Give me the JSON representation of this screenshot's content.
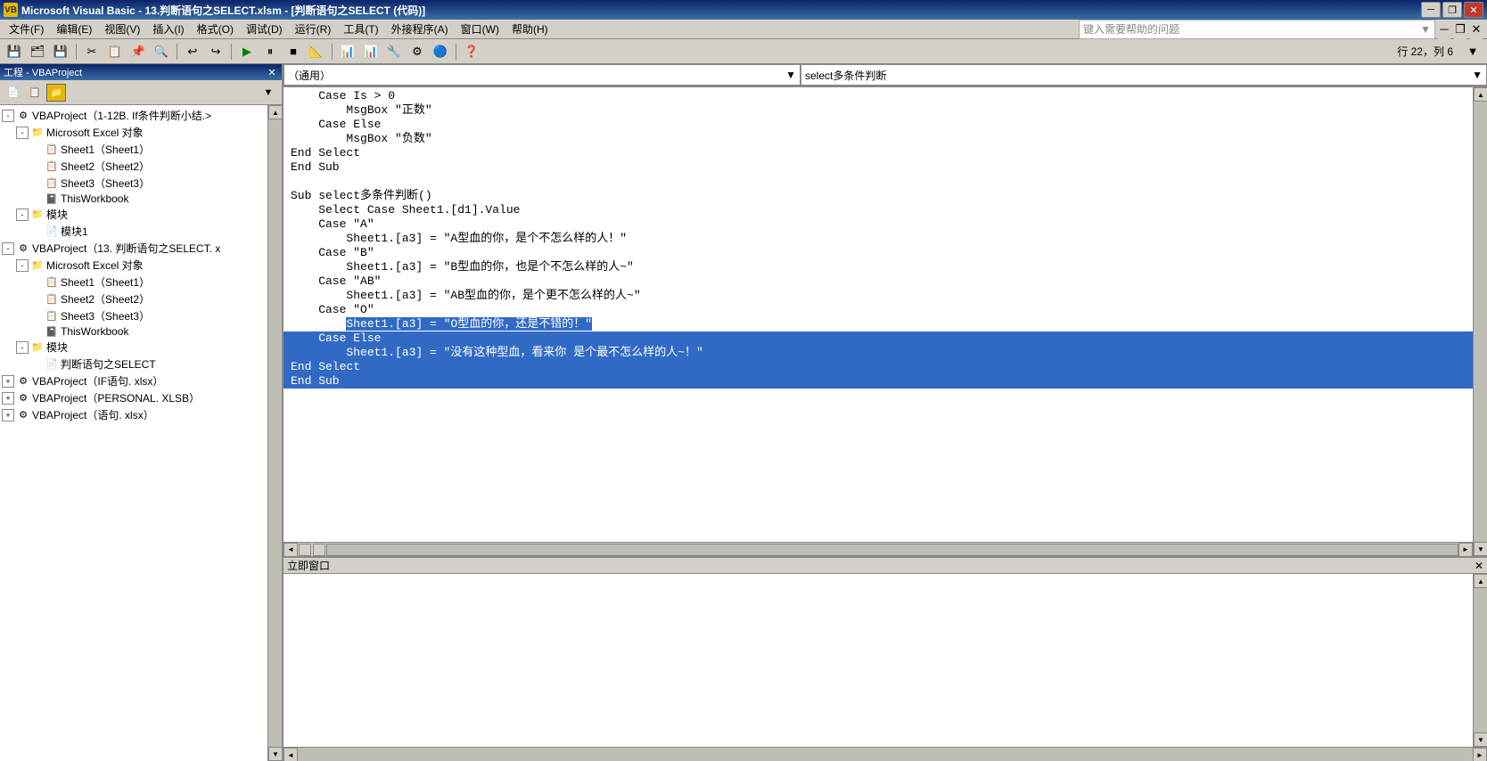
{
  "titleBar": {
    "title": "Microsoft Visual Basic - 13.判断语句之SELECT.xlsm - [判断语句之SELECT (代码)]",
    "icon": "VB",
    "controls": {
      "minimize": "─",
      "maximize": "□",
      "close": "✕",
      "restore": "❐",
      "restore2": "✕"
    }
  },
  "menuBar": {
    "items": [
      {
        "label": "文件(F)",
        "id": "file"
      },
      {
        "label": "编辑(E)",
        "id": "edit"
      },
      {
        "label": "视图(V)",
        "id": "view"
      },
      {
        "label": "插入(I)",
        "id": "insert"
      },
      {
        "label": "格式(O)",
        "id": "format"
      },
      {
        "label": "调试(D)",
        "id": "debug"
      },
      {
        "label": "运行(R)",
        "id": "run"
      },
      {
        "label": "工具(T)",
        "id": "tools"
      },
      {
        "label": "外接程序(A)",
        "id": "addins"
      },
      {
        "label": "窗口(W)",
        "id": "window"
      },
      {
        "label": "帮助(H)",
        "id": "help"
      }
    ],
    "helpPlaceholder": "键入需要帮助的问题"
  },
  "toolbar": {
    "statusText": "行 22，列 6"
  },
  "leftPanel": {
    "title": "工程 - VBAProject",
    "toolbarButtons": [
      "view-code",
      "view-object",
      "toggle-folders"
    ],
    "tree": [
      {
        "indent": 0,
        "expand": "-",
        "icon": "⚙",
        "label": "VBAProject（1-12B. If条件判断小结.>",
        "id": "proj1",
        "level": 0
      },
      {
        "indent": 1,
        "expand": "-",
        "icon": "📁",
        "label": "Microsoft Excel 对象",
        "id": "excel-obj-1",
        "level": 1
      },
      {
        "indent": 2,
        "expand": null,
        "icon": "📋",
        "label": "Sheet1（Sheet1）",
        "id": "sheet1-1",
        "level": 2
      },
      {
        "indent": 2,
        "expand": null,
        "icon": "📋",
        "label": "Sheet2（Sheet2）",
        "id": "sheet2-1",
        "level": 2
      },
      {
        "indent": 2,
        "expand": null,
        "icon": "📋",
        "label": "Sheet3（Sheet3）",
        "id": "sheet3-1",
        "level": 2
      },
      {
        "indent": 2,
        "expand": null,
        "icon": "📓",
        "label": "ThisWorkbook",
        "id": "thiswb-1",
        "level": 2
      },
      {
        "indent": 1,
        "expand": "-",
        "icon": "📁",
        "label": "模块",
        "id": "modules-1",
        "level": 1
      },
      {
        "indent": 2,
        "expand": null,
        "icon": "📄",
        "label": "模块1",
        "id": "module1-1",
        "level": 2
      },
      {
        "indent": 0,
        "expand": "-",
        "icon": "⚙",
        "label": "VBAProject（13. 判断语句之SELECT. x",
        "id": "proj2",
        "level": 0
      },
      {
        "indent": 1,
        "expand": "-",
        "icon": "📁",
        "label": "Microsoft Excel 对象",
        "id": "excel-obj-2",
        "level": 1
      },
      {
        "indent": 2,
        "expand": null,
        "icon": "📋",
        "label": "Sheet1（Sheet1）",
        "id": "sheet1-2",
        "level": 2
      },
      {
        "indent": 2,
        "expand": null,
        "icon": "📋",
        "label": "Sheet2（Sheet2）",
        "id": "sheet2-2",
        "level": 2
      },
      {
        "indent": 2,
        "expand": null,
        "icon": "📋",
        "label": "Sheet3（Sheet3）",
        "id": "sheet3-2",
        "level": 2
      },
      {
        "indent": 2,
        "expand": null,
        "icon": "📓",
        "label": "ThisWorkbook",
        "id": "thiswb-2",
        "level": 2
      },
      {
        "indent": 1,
        "expand": "-",
        "icon": "📁",
        "label": "模块",
        "id": "modules-2",
        "level": 1
      },
      {
        "indent": 2,
        "expand": null,
        "icon": "📄",
        "label": "判断语句之SELECT",
        "id": "module-select",
        "level": 2
      },
      {
        "indent": 0,
        "expand": "+",
        "icon": "⚙",
        "label": "VBAProject（IF语句. xlsx）",
        "id": "proj3",
        "level": 0
      },
      {
        "indent": 0,
        "expand": "+",
        "icon": "⚙",
        "label": "VBAProject（PERSONAL. XLSB）",
        "id": "proj4",
        "level": 0
      },
      {
        "indent": 0,
        "expand": "+",
        "icon": "⚙",
        "label": "VBAProject（语句. xlsx）",
        "id": "proj5",
        "level": 0
      }
    ]
  },
  "codePanel": {
    "dropdownLeft": "（通用）",
    "dropdownRight": "select多条件判断",
    "lines": [
      {
        "text": "    Case Is > 0",
        "selected": false,
        "id": 1
      },
      {
        "text": "        MsgBox \"正数\"",
        "selected": false,
        "id": 2
      },
      {
        "text": "    Case Else",
        "selected": false,
        "id": 3
      },
      {
        "text": "        MsgBox \"负数\"",
        "selected": false,
        "id": 4
      },
      {
        "text": "End Select",
        "selected": false,
        "id": 5
      },
      {
        "text": "End Sub",
        "selected": false,
        "id": 6
      },
      {
        "text": "",
        "selected": false,
        "id": 7
      },
      {
        "text": "Sub select多条件判断()",
        "selected": false,
        "id": 8
      },
      {
        "text": "    Select Case Sheet1.[d1].Value",
        "selected": false,
        "id": 9
      },
      {
        "text": "    Case \"A\"",
        "selected": false,
        "id": 10
      },
      {
        "text": "        Sheet1.[a3] = \"A型血的你，是个不怎么样的人！\"",
        "selected": false,
        "id": 11
      },
      {
        "text": "    Case \"B\"",
        "selected": false,
        "id": 12
      },
      {
        "text": "        Sheet1.[a3] = \"B型血的你，也是个不怎么样的人~\"",
        "selected": false,
        "id": 13
      },
      {
        "text": "    Case \"AB\"",
        "selected": false,
        "id": 14
      },
      {
        "text": "        Sheet1.[a3] = \"AB型血的你，是个更不怎么样的人~\"",
        "selected": false,
        "id": 15
      },
      {
        "text": "    Case \"O\"",
        "selected": false,
        "id": 16
      },
      {
        "text": "        Sheet1.[a3] = \"O型血的你，还是不错的！\"",
        "selected": true,
        "id": 17,
        "partialStart": 8
      },
      {
        "text": "    Case Else",
        "selected": true,
        "id": 18
      },
      {
        "text": "        Sheet1.[a3] = \"没有这种型血，看来你 是个最不怎么样的人~！\"",
        "selected": true,
        "id": 19
      },
      {
        "text": "End Select",
        "selected": true,
        "id": 20
      },
      {
        "text": "End Sub",
        "selected": true,
        "id": 21
      }
    ]
  },
  "immediateWindow": {
    "title": "立即窗口",
    "closeButton": "✕"
  }
}
